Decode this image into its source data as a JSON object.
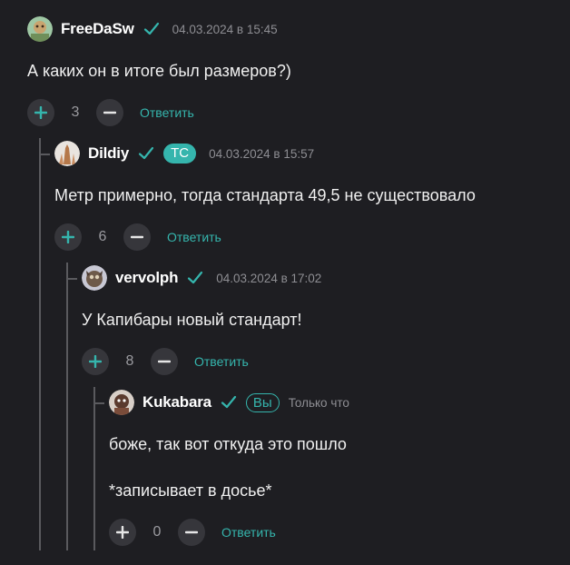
{
  "colors": {
    "accent": "#35b5ad",
    "background": "#1e1e22",
    "button": "#36363b",
    "muted": "#8e8e93"
  },
  "comments": [
    {
      "username": "FreeDaSw",
      "timestamp": "04.03.2024 в 15:45",
      "text": "А каких он в итоге был размеров?)",
      "score": "3",
      "reply_label": "Ответить",
      "upvote_icon": "plus-icon",
      "downvote_icon": "minus-icon"
    },
    {
      "username": "Dildiy",
      "badge": "ТС",
      "timestamp": "04.03.2024 в 15:57",
      "text": "Метр примерно, тогда стандарта 49,5 не существовало",
      "score": "6",
      "reply_label": "Ответить"
    },
    {
      "username": "vervolph",
      "timestamp": "04.03.2024 в 17:02",
      "text": "У Капибары новый стандарт!",
      "score": "8",
      "reply_label": "Ответить"
    },
    {
      "username": "Kukabara",
      "badge": "Вы",
      "timestamp": "Только что",
      "text_lines": [
        "боже, так вот откуда это пошло",
        "*записывает в досье*"
      ],
      "score": "0",
      "reply_label": "Ответить"
    }
  ]
}
